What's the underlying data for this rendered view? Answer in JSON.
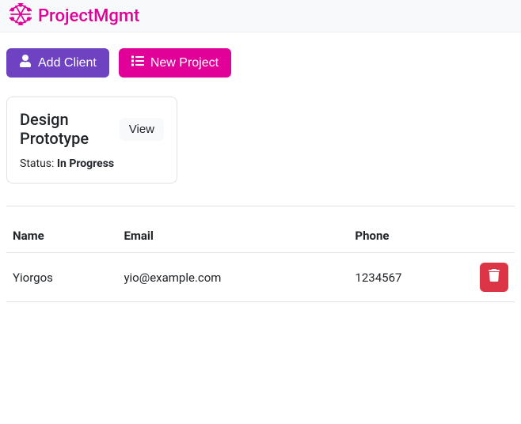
{
  "navbar": {
    "brand": "ProjectMgmt"
  },
  "buttons": {
    "add_client": "Add Client",
    "new_project": "New Project",
    "view": "View"
  },
  "projects": [
    {
      "title": "Design Prototype",
      "status_label": "Status: ",
      "status_value": "In Progress"
    }
  ],
  "table": {
    "headers": {
      "name": "Name",
      "email": "Email",
      "phone": "Phone"
    },
    "rows": [
      {
        "name": "Yiorgos",
        "email": "yio@example.com",
        "phone": "1234567"
      }
    ]
  }
}
